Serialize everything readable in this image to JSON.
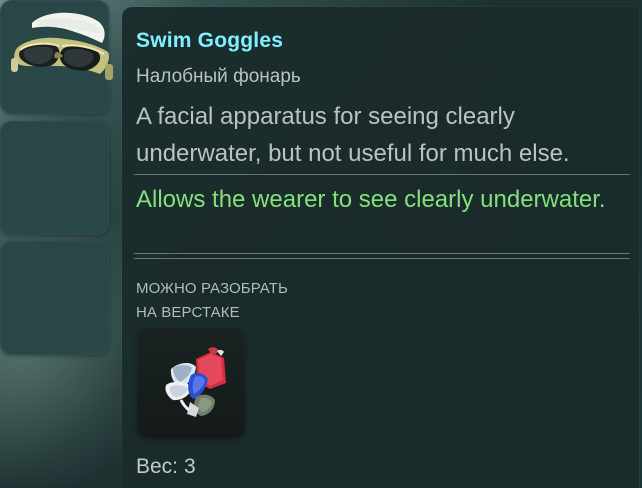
{
  "item": {
    "title": "Swim Goggles",
    "subtitle": "Налобный фонарь",
    "description": "A facial apparatus for seeing clearly underwater, but not useful for much else.",
    "effect": "Allows the wearer to see clearly underwater."
  },
  "salvage": {
    "line_1": "МОЖНО РАЗОБРАТЬ",
    "line_2": "НА ВЕРСТАКЕ",
    "icon": "salvage-materials-icon"
  },
  "weight": {
    "label": "Вес:",
    "value": "3"
  },
  "icons": {
    "equipped_item": "swim-goggles-icon"
  },
  "colors": {
    "title": "#7ef0ff",
    "effect": "#84e07c",
    "panel": "#1b2b2b",
    "slot": "#294747"
  }
}
